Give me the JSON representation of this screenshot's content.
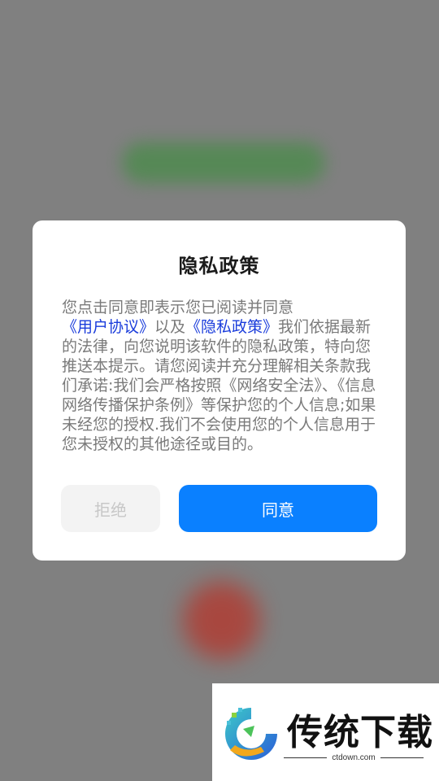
{
  "dialog": {
    "title": "隐私政策",
    "body": {
      "p1": "您点击同意即表示您已阅读并同意",
      "link_user_agreement": "《用户协议》",
      "p2": "以及",
      "link_privacy_policy": "《隐私政策》",
      "p3": "我们依据最新的法律，向您说明该软件的隐私政策，特向您推送本提示。请您阅读并充分理解相关条款我们承诺:我们会严格按照《网络安全法》、《信息网络传播保护条例》等保护您的个人信息;如果未经您的授权.我们不会使用您的个人信息用于您未授权的其他途径或目的。"
    },
    "reject_label": "拒绝",
    "agree_label": "同意"
  },
  "watermark": {
    "brand": "传统下载",
    "site": "ctdown.com"
  },
  "colors": {
    "accent": "#0a80ff",
    "link": "#1a3cdb",
    "overlay": "#808080"
  }
}
